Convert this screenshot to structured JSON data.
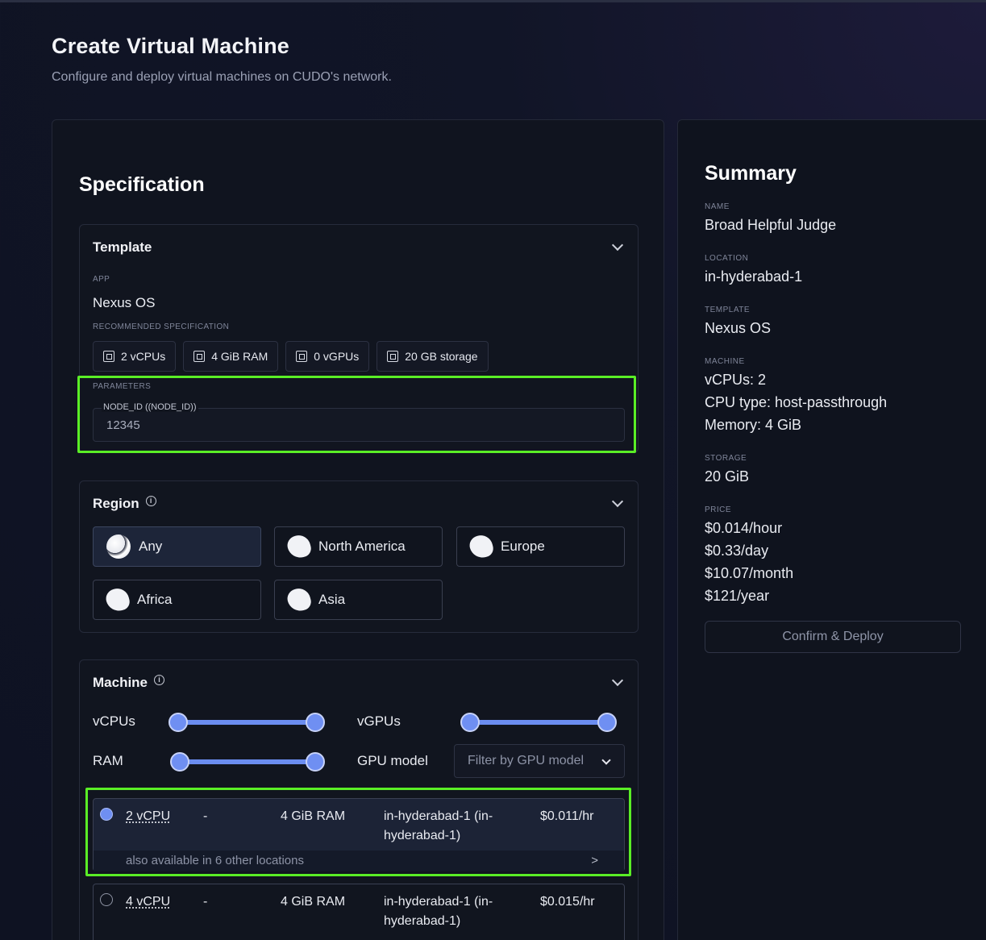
{
  "page": {
    "title": "Create Virtual Machine",
    "subtitle": "Configure and deploy virtual machines on CUDO's network."
  },
  "spec": {
    "title": "Specification",
    "template": {
      "heading": "Template",
      "app_label": "APP",
      "app_value": "Nexus OS",
      "rec_label": "RECOMMENDED SPECIFICATION",
      "chips": [
        "2 vCPUs",
        "4 GiB RAM",
        "0 vGPUs",
        "20 GB storage"
      ],
      "params_label": "PARAMETERS",
      "param_field_label": "NODE_ID ((NODE_ID))",
      "param_field_value": "12345"
    },
    "region": {
      "heading": "Region",
      "options": [
        "Any",
        "North America",
        "Europe",
        "Africa",
        "Asia"
      ],
      "selected": "Any"
    },
    "machine": {
      "heading": "Machine",
      "vcpus_label": "vCPUs",
      "vgpus_label": "vGPUs",
      "ram_label": "RAM",
      "gpu_model_label": "GPU model",
      "gpu_model_placeholder": "Filter by GPU model",
      "rows": [
        {
          "cpu": "2 vCPU",
          "dash": "-",
          "ram": "4 GiB RAM",
          "location_line1": "in-hyderabad-1 (in-",
          "location_line2": "hyderabad-1)",
          "price": "$0.011/hr",
          "also": "also available in 6 other locations",
          "arrow": ">"
        },
        {
          "cpu": "4 vCPU",
          "dash": "-",
          "ram": "4 GiB RAM",
          "location_line1": "in-hyderabad-1 (in-",
          "location_line2": "hyderabad-1)",
          "price": "$0.015/hr"
        }
      ]
    }
  },
  "summary": {
    "title": "Summary",
    "name_label": "NAME",
    "name_value": "Broad Helpful Judge",
    "location_label": "LOCATION",
    "location_value": "in-hyderabad-1",
    "template_label": "TEMPLATE",
    "template_value": "Nexus OS",
    "machine_label": "MACHINE",
    "machine_lines": [
      "vCPUs: 2",
      "CPU type: host-passthrough",
      "Memory: 4 GiB"
    ],
    "storage_label": "STORAGE",
    "storage_value": "20 GiB",
    "price_label": "PRICE",
    "price_lines": [
      "$0.014/hour",
      "$0.33/day",
      "$10.07/month",
      "$121/year"
    ],
    "deploy_label": "Confirm & Deploy"
  },
  "colors": {
    "accent": "#6f8ff2",
    "highlight": "#5aee26",
    "background": "#111527"
  }
}
